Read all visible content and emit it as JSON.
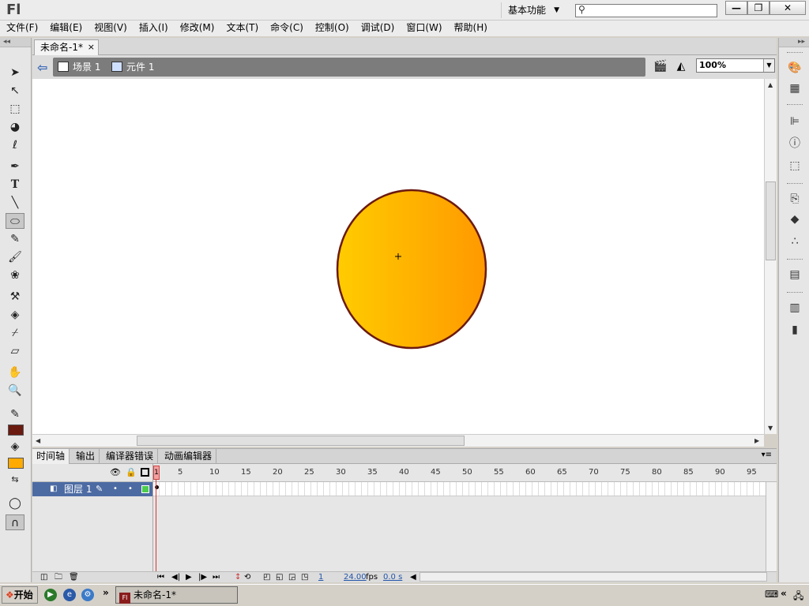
{
  "app": {
    "logo": "Fl"
  },
  "titlebar": {
    "workspace": "基本功能",
    "search_placeholder": ""
  },
  "window_buttons": {
    "minimize": "—",
    "restore": "❐",
    "close": "✕"
  },
  "menu": [
    "文件(F)",
    "编辑(E)",
    "视图(V)",
    "插入(I)",
    "修改(M)",
    "文本(T)",
    "命令(C)",
    "控制(O)",
    "调试(D)",
    "窗口(W)",
    "帮助(H)"
  ],
  "document": {
    "tab_title": "未命名-1*",
    "tab_close": "×"
  },
  "editbar": {
    "scene": "场景 1",
    "symbol": "元件 1",
    "zoom": "100%"
  },
  "colors": {
    "stroke": "#6b1a10",
    "fill": "#ffaa00",
    "fill_gradient_start": "#ffcc00",
    "fill_gradient_end": "#ff9900"
  },
  "timeline": {
    "tabs": [
      "时间轴",
      "输出",
      "编译器错误",
      "动画编辑器"
    ],
    "frame_numbers": [
      "1",
      "5",
      "10",
      "15",
      "20",
      "25",
      "30",
      "35",
      "40",
      "45",
      "50",
      "55",
      "60",
      "65",
      "70",
      "75",
      "80",
      "85",
      "90",
      "95"
    ],
    "layer_name": "图层 1",
    "current_frame": "1",
    "fps": "24.00",
    "fps_unit": "fps",
    "time": "0.0 s"
  },
  "taskbar": {
    "start": "开始",
    "task_title": "未命名-1*",
    "task_icon": "Fl"
  }
}
